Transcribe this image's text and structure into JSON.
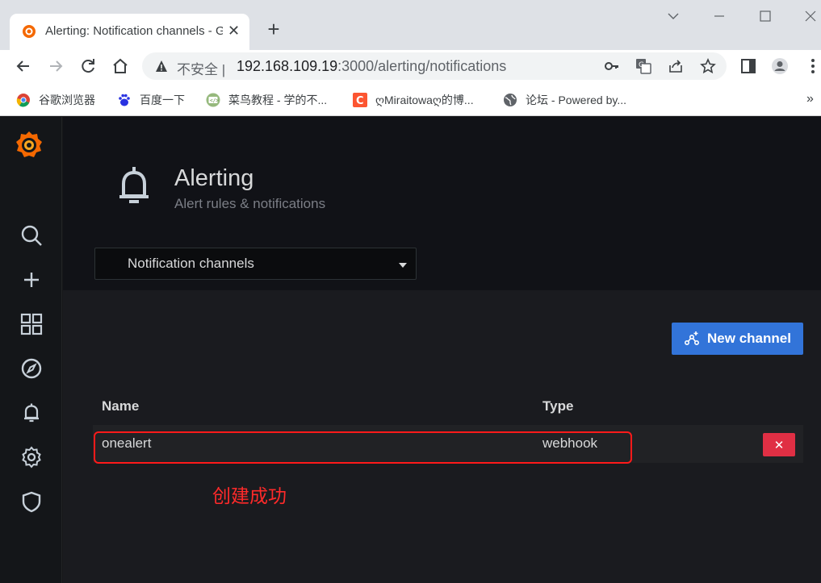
{
  "browser": {
    "tab": {
      "title": "Alerting: Notification channels - Grafana",
      "favicon": "grafana-logo-icon"
    },
    "address": {
      "insecure_label": "不安全",
      "separator": "|",
      "host": "192.168.109.19",
      "rest": ":3000/alerting/notifications"
    },
    "bookmarks": [
      {
        "label": "谷歌浏览器",
        "icon": "chrome-icon"
      },
      {
        "label": "百度一下",
        "icon": "baidu-icon"
      },
      {
        "label": "菜鸟教程 - 学的不...",
        "icon": "runoob-icon"
      },
      {
        "label": "ღMiraitowaღ的博...",
        "icon": "csdn-icon"
      },
      {
        "label": "论坛 - Powered by...",
        "icon": "globe-icon"
      }
    ],
    "bookmarks_overflow": "»"
  },
  "sidemenu": {
    "items": [
      {
        "name": "search-icon"
      },
      {
        "name": "create-plus-icon"
      },
      {
        "name": "dashboards-grid-icon"
      },
      {
        "name": "explore-compass-icon"
      },
      {
        "name": "alerting-bell-icon"
      },
      {
        "name": "configuration-gear-icon"
      },
      {
        "name": "server-admin-shield-icon"
      }
    ]
  },
  "header": {
    "title": "Alerting",
    "subtitle": "Alert rules & notifications",
    "select_value": "Notification channels"
  },
  "main": {
    "new_button_label": "New channel",
    "columns": {
      "name": "Name",
      "type": "Type"
    },
    "rows": [
      {
        "name": "onealert",
        "type": "webhook",
        "delete_label": "✕"
      }
    ],
    "annotation_text": "创建成功"
  },
  "colors": {
    "primary_button": "#3274d9",
    "danger_button": "#e02f44",
    "annotation_red": "#ff2a2a",
    "grafana_orange": "#f46800"
  }
}
